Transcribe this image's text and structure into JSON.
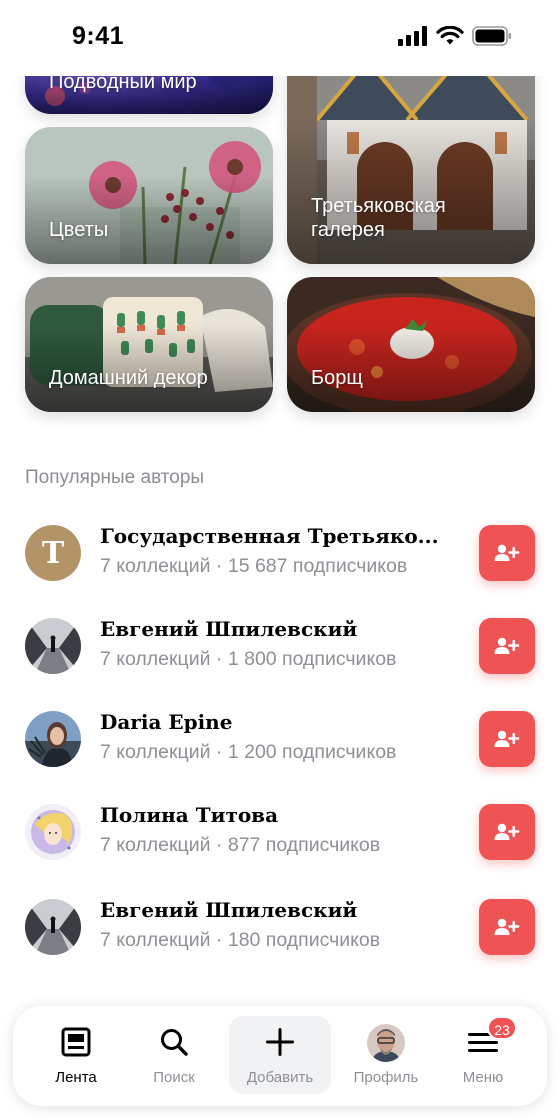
{
  "status": {
    "time": "9:41"
  },
  "tiles": [
    {
      "label": "Подводный мир"
    },
    {
      "label": "Цветы"
    },
    {
      "label": "Третьяковская галерея"
    },
    {
      "label": "Домашний декор"
    },
    {
      "label": "Борщ"
    }
  ],
  "popular": {
    "title": "Популярные авторы",
    "authors": [
      {
        "name": "Государственная Третьяко...",
        "stats": "7 коллекций · 15 687 подписчиков",
        "avatar": "letter-T",
        "avatar_letter": "T"
      },
      {
        "name": "Евгений Шпилевский",
        "stats": "7 коллекций · 1 800 подписчиков",
        "avatar": "photo-person-road"
      },
      {
        "name": "Daria Epine",
        "stats": "7 коллекций · 1 200 подписчиков",
        "avatar": "photo-woman"
      },
      {
        "name": "Полина Титова",
        "stats": "7 коллекций · 877 подписчиков",
        "avatar": "illustration-girl"
      },
      {
        "name": "Евгений Шпилевский",
        "stats": "7 коллекций · 180 подписчиков",
        "avatar": "photo-person-road"
      }
    ],
    "follow_icon": "add-user-icon"
  },
  "nav": {
    "items": [
      {
        "label": "Лента",
        "icon": "feed-icon",
        "active": true
      },
      {
        "label": "Поиск",
        "icon": "search-icon"
      },
      {
        "label": "Добавить",
        "icon": "plus-icon"
      },
      {
        "label": "Профиль",
        "icon": "profile-avatar"
      },
      {
        "label": "Меню",
        "icon": "menu-icon"
      }
    ],
    "menu_badge": "23"
  },
  "colors": {
    "accent": "#f05353",
    "muted": "#8e9096"
  }
}
